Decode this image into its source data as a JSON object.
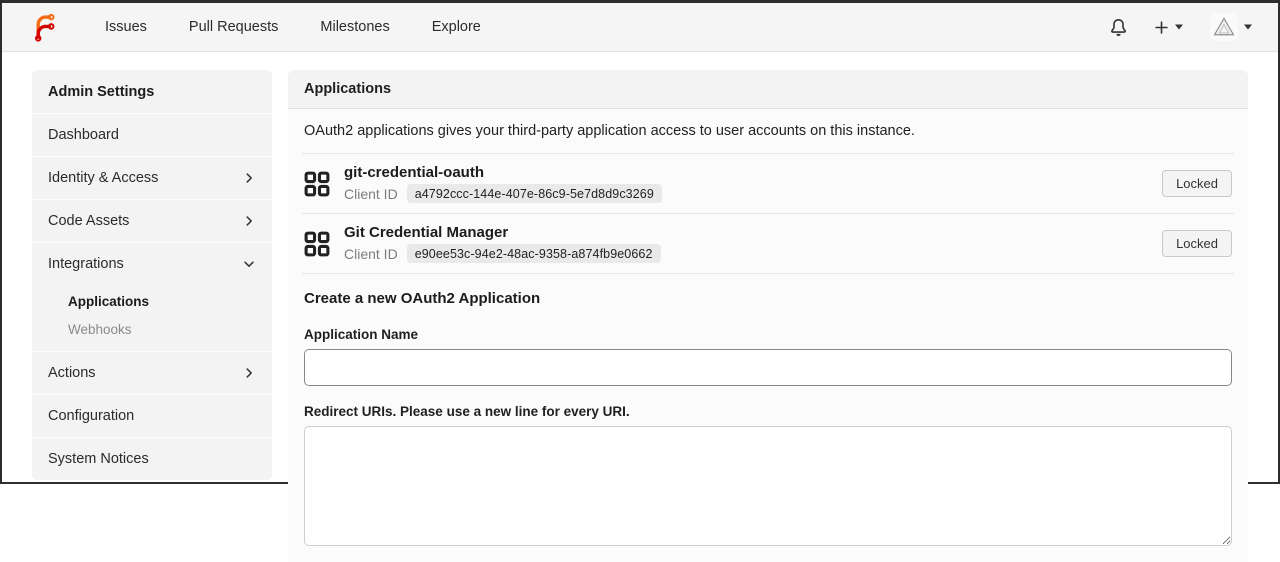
{
  "navbar": {
    "logo_name": "forgejo",
    "items": [
      {
        "label": "Issues"
      },
      {
        "label": "Pull Requests"
      },
      {
        "label": "Milestones"
      },
      {
        "label": "Explore"
      }
    ]
  },
  "sidebar": {
    "title": "Admin Settings",
    "items": [
      {
        "label": "Dashboard"
      },
      {
        "label": "Identity & Access"
      },
      {
        "label": "Code Assets"
      },
      {
        "label": "Integrations"
      },
      {
        "label": "Actions"
      },
      {
        "label": "Configuration"
      },
      {
        "label": "System Notices"
      }
    ],
    "integrations_children": [
      {
        "label": "Applications"
      },
      {
        "label": "Webhooks"
      }
    ]
  },
  "main": {
    "header": "Applications",
    "description": "OAuth2 applications gives your third-party application access to user accounts on this instance.",
    "client_id_label": "Client ID",
    "applications": [
      {
        "name": "git-credential-oauth",
        "client_id": "a4792ccc-144e-407e-86c9-5e7d8d9c3269",
        "locked_label": "Locked"
      },
      {
        "name": "Git Credential Manager",
        "client_id": "e90ee53c-94e2-48ac-9358-a874fb9e0662",
        "locked_label": "Locked"
      }
    ],
    "form": {
      "title": "Create a new OAuth2 Application",
      "app_name_label": "Application Name",
      "redirect_label": "Redirect URIs. Please use a new line for every URI."
    }
  },
  "colors": {
    "brand_orange": "#f36d16",
    "brand_red": "#d40000",
    "navbar_bg": "#f5f5f6",
    "panel_header_bg": "#f3f3f4",
    "badge_bg": "#e9e9ea"
  }
}
